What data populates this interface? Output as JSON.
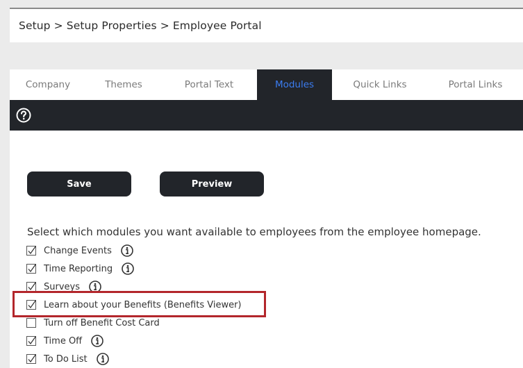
{
  "breadcrumb": {
    "text": "Setup > Setup Properties > Employee Portal"
  },
  "tabs": [
    {
      "label": "Company",
      "active": false
    },
    {
      "label": "Themes",
      "active": false
    },
    {
      "label": "Portal Text",
      "active": false
    },
    {
      "label": "Modules",
      "active": true
    },
    {
      "label": "Quick Links",
      "active": false
    },
    {
      "label": "Portal Links",
      "active": false
    }
  ],
  "toolbar": {
    "help_icon": "question-circle-icon"
  },
  "actions": {
    "save_label": "Save",
    "preview_label": "Preview"
  },
  "modules_section": {
    "instructions": "Select which modules you want available to employees from the employee homepage.",
    "items": [
      {
        "label": "Change Events",
        "checked": true,
        "has_info": true
      },
      {
        "label": "Time Reporting",
        "checked": true,
        "has_info": true
      },
      {
        "label": "Surveys",
        "checked": true,
        "has_info": true
      },
      {
        "label": "Learn about your Benefits (Benefits Viewer)",
        "checked": true,
        "has_info": false,
        "highlighted": true
      },
      {
        "label": "Turn off Benefit Cost Card",
        "checked": false,
        "has_info": false
      },
      {
        "label": "Time Off",
        "checked": true,
        "has_info": true
      },
      {
        "label": "To Do List",
        "checked": true,
        "has_info": true
      }
    ]
  },
  "colors": {
    "dark_bar": "#22252a",
    "active_tab_text": "#3b7cf0",
    "highlight_border": "#b3262b"
  }
}
